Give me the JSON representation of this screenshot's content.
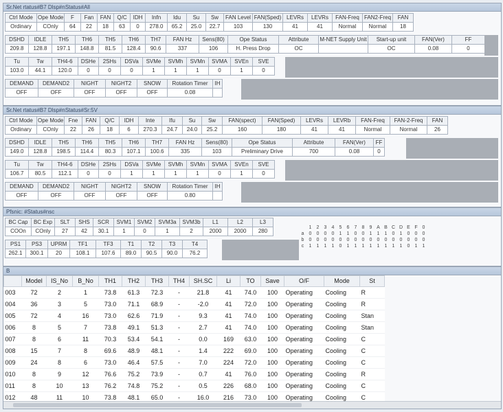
{
  "panel1": {
    "title": "Sr.Net rtatus#B7 Dlsp#nStatus#All",
    "row1": {
      "headers": [
        "Ctrl Mode",
        "Ope Mode",
        "F",
        "Fan",
        "FAN",
        "Q/C",
        "IDH",
        "Infn",
        "Idu",
        "Su",
        "Sw",
        "FAN Level",
        "FAN(Sped)",
        "LEVRs",
        "LEVRs",
        "FAN-Freq",
        "FAN2-Freq",
        "FAN"
      ],
      "values": [
        "Ordinary",
        "COnly",
        "64",
        "22",
        "18",
        "63",
        "0",
        "278.0",
        "65.2",
        "25.0",
        "22.7",
        "103",
        "130",
        "41",
        "41",
        "Normal",
        "Normal",
        "18"
      ]
    },
    "row2": {
      "headers": [
        "DSHD",
        "IDLE",
        "TH5",
        "TH6",
        "TH5",
        "TH6",
        "TH7",
        "FAN Hz",
        "Sens(80)",
        "Ope Status",
        "Attribute",
        "M-NET Supply Unit",
        "Start-up unit",
        "FAN(Ver)",
        "FF"
      ],
      "values": [
        "209.8",
        "128.8",
        "197.1",
        "148.8",
        "81.5",
        "128.4",
        "90.6",
        "337",
        "106",
        "H. Press Drop",
        "OC",
        "",
        "OC",
        "0.08",
        "0"
      ]
    },
    "row3": {
      "headers": [
        "Tu",
        "Tw",
        "TH4-6",
        "DSHe",
        "2SHs",
        "DSVa",
        "SVMe",
        "SVMh",
        "SVMn",
        "SVMA",
        "SVEn",
        "SVE"
      ],
      "values": [
        "103.0",
        "44.1",
        "120.0",
        "0",
        "0",
        "0",
        "1",
        "1",
        "1",
        "0",
        "1",
        "0"
      ]
    },
    "row4": {
      "headers": [
        "DEMAND",
        "DEMAND2",
        "NIGHT",
        "NIGHT2",
        "SNOW",
        "Rotation Timer",
        "IH"
      ],
      "values": [
        "OFF",
        "OFF",
        "OFF",
        "OFF",
        "OFF",
        "0.08",
        ""
      ]
    }
  },
  "panel2": {
    "title": "Sr.Net rtatus#B7 Dlsp#nStatus#Sr:5V",
    "row1": {
      "headers": [
        "Ctrl Mode",
        "Ope Mode",
        "Fne",
        "FAN",
        "Q/C",
        "IDH",
        "Inte",
        "Ifu",
        "Su",
        "Sw",
        "FAN(spect)",
        "FAN(Sped)",
        "LEVRs",
        "LEVRb",
        "FAN-Freq",
        "FAN-2-Freq",
        "FAN"
      ],
      "values": [
        "Ordinary",
        "COnly",
        "22",
        "26",
        "18",
        "6",
        "270.3",
        "24.7",
        "24.0",
        "25.2",
        "160",
        "180",
        "41",
        "41",
        "Normal",
        "Normal",
        "26"
      ]
    },
    "row2": {
      "headers": [
        "DSHD",
        "IDLE",
        "TH5",
        "TH6",
        "TH5",
        "TH6",
        "TH7",
        "FAN Hz",
        "Sens(80)",
        "Ope Status",
        "Attribute",
        "FAN(Ver)",
        "FF"
      ],
      "values": [
        "149.0",
        "128.8",
        "198.5",
        "114.4",
        "80.3",
        "107.1",
        "100.6",
        "335",
        "103",
        "Preliminary Drive",
        "700",
        "0.08",
        "0"
      ]
    },
    "row3": {
      "headers": [
        "Tu",
        "Tw",
        "TH4-6",
        "DSHe",
        "2SHs",
        "DSVa",
        "SVMe",
        "SVMh",
        "SVMn",
        "SVMA",
        "SVEn",
        "SVE"
      ],
      "values": [
        "106.7",
        "80.5",
        "112.1",
        "0",
        "0",
        "1",
        "1",
        "1",
        "1",
        "0",
        "1",
        "0"
      ]
    },
    "row4": {
      "headers": [
        "DEMAND",
        "DEMAND2",
        "NIGHT",
        "NIGHT2",
        "SNOW",
        "Rotation Timer",
        "IH"
      ],
      "values": [
        "OFF",
        "OFF",
        "OFF",
        "OFF",
        "OFF",
        "0.80",
        ""
      ]
    }
  },
  "panel3": {
    "title": "Pfsnic: #Status#nsc",
    "row1": {
      "headers": [
        "BC Cap",
        "BC Exp",
        "SLT",
        "SHS",
        "SCR",
        "SVM1",
        "SVM2",
        "SVM3a",
        "SVM3b",
        "L1",
        "L2",
        "L3"
      ],
      "values": [
        "COOn",
        "COnly",
        "27",
        "42",
        "30.1",
        "1",
        "0",
        "1",
        "2",
        "2000",
        "2000",
        "280"
      ]
    },
    "row2": {
      "headers": [
        "PS1",
        "PS3",
        "UPRM",
        "TF1",
        "TF3",
        "T1",
        "T2",
        "T3",
        "T4"
      ],
      "values": [
        "262.1",
        "300.1",
        "20",
        "108.1",
        "107.6",
        "89.0",
        "90.5",
        "90.0",
        "76.2"
      ]
    },
    "bits_header": [
      "1",
      "2",
      "3",
      "4",
      "5",
      "6",
      "7",
      "8",
      "9",
      "A",
      "B",
      "C",
      "D",
      "E",
      "F",
      "0"
    ],
    "bits_row_a": [
      "0",
      "0",
      "0",
      "0",
      "1",
      "1",
      "0",
      "0",
      "1",
      "1",
      "1",
      "0",
      "1",
      "0",
      "0",
      "0"
    ],
    "bits_row_b": [
      "0",
      "0",
      "0",
      "0",
      "0",
      "0",
      "0",
      "0",
      "0",
      "0",
      "0",
      "0",
      "0",
      "0",
      "0",
      "0"
    ],
    "bits_row_c": [
      "1",
      "1",
      "1",
      "1",
      "0",
      "1",
      "1",
      "1",
      "1",
      "1",
      "1",
      "1",
      "1",
      "0",
      "1",
      "1"
    ],
    "bits_labels": [
      "a",
      "b",
      "c"
    ]
  },
  "panel4": {
    "title": "B",
    "headers": [
      "",
      "Model",
      "IS_No",
      "B_No",
      "TH1",
      "TH2",
      "TH3",
      "TH4",
      "SH.SC",
      "Li",
      "TO",
      "Save",
      "O/F",
      "Mode",
      "St"
    ],
    "rows": [
      [
        "003",
        "72",
        "2",
        "1",
        "73.8",
        "61.3",
        "72.3",
        "-",
        "21.8",
        "41",
        "74.0",
        "100",
        "Operating",
        "Cooling",
        "R"
      ],
      [
        "004",
        "36",
        "3",
        "5",
        "73.0",
        "71.1",
        "68.9",
        "-",
        "-2.0",
        "41",
        "72.0",
        "100",
        "Operating",
        "Cooling",
        "R"
      ],
      [
        "005",
        "72",
        "4",
        "16",
        "73.0",
        "62.6",
        "71.9",
        "-",
        "9.3",
        "41",
        "74.0",
        "100",
        "Operating",
        "Cooling",
        "Stan"
      ],
      [
        "006",
        "8",
        "5",
        "7",
        "73.8",
        "49.1",
        "51.3",
        "-",
        "2.7",
        "41",
        "74.0",
        "100",
        "Operating",
        "Cooling",
        "Stan"
      ],
      [
        "007",
        "8",
        "6",
        "11",
        "70.3",
        "53.4",
        "54.1",
        "-",
        "0.0",
        "169",
        "63.0",
        "100",
        "Operating",
        "Cooling",
        "C"
      ],
      [
        "008",
        "15",
        "7",
        "8",
        "69.6",
        "48.9",
        "48.1",
        "-",
        "1.4",
        "222",
        "69.0",
        "100",
        "Operating",
        "Cooling",
        "C"
      ],
      [
        "009",
        "24",
        "8",
        "6",
        "73.0",
        "46.4",
        "57.5",
        "-",
        "7.0",
        "224",
        "72.0",
        "100",
        "Operating",
        "Cooling",
        "C"
      ],
      [
        "010",
        "8",
        "9",
        "12",
        "76.6",
        "75.2",
        "73.9",
        "-",
        "0.7",
        "41",
        "76.0",
        "100",
        "Operating",
        "Cooling",
        "R"
      ],
      [
        "011",
        "8",
        "10",
        "13",
        "76.2",
        "74.8",
        "75.2",
        "-",
        "0.5",
        "226",
        "68.0",
        "100",
        "Operating",
        "Cooling",
        "C"
      ],
      [
        "012",
        "48",
        "11",
        "10",
        "73.8",
        "48.1",
        "65.0",
        "-",
        "16.0",
        "216",
        "73.0",
        "100",
        "Operating",
        "Cooling",
        "C"
      ]
    ]
  },
  "colors": {
    "background": "#e9edf2",
    "titlebar": "#c1cfe2",
    "gray_fill": "#a9aeb5",
    "grid": "#a9b2bf"
  }
}
